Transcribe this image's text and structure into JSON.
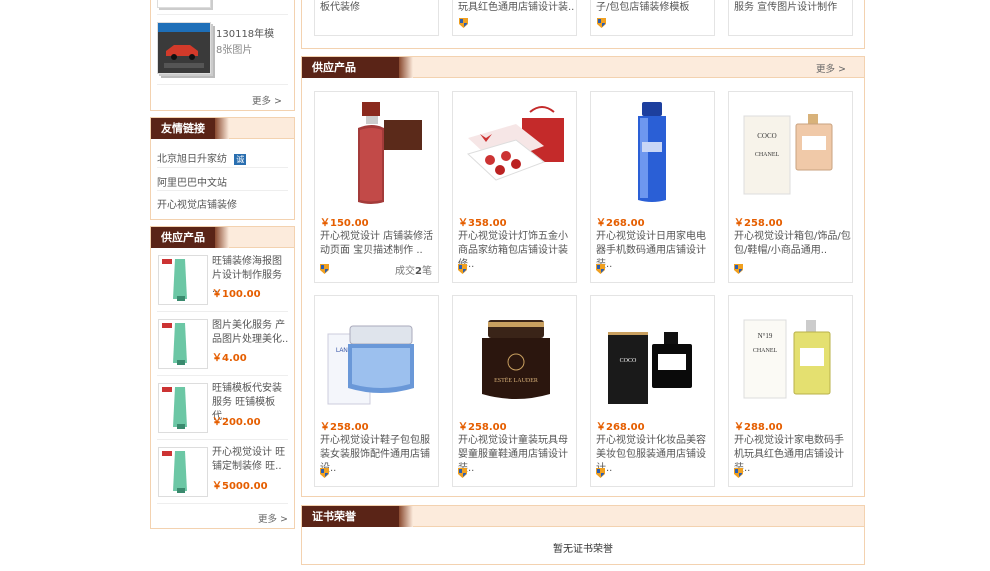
{
  "top_strip": {
    "items": [
      "板代装修",
      "玩具红色通用店铺设计装..",
      "子/包包店铺装修模板",
      "服务 宣传图片设计制作"
    ]
  },
  "side_album": {
    "title": "130118年模",
    "count": "8张图片",
    "more": "更多 >"
  },
  "friend_links": {
    "title": "友情链接",
    "links": [
      "北京旭日升家纺",
      "阿里巴巴中文站",
      "开心视觉店铺装修"
    ],
    "badge": "诚"
  },
  "side_supply": {
    "title": "供应产品",
    "more": "更多 >",
    "items": [
      {
        "name": "旺铺装修海报图片设计制作服务 ..",
        "price": "￥100.00"
      },
      {
        "name": "图片美化服务 产品图片处理美化..",
        "price": "￥4.00"
      },
      {
        "name": "旺铺模板代安装服务 旺铺模板代..",
        "price": "￥200.00"
      },
      {
        "name": "开心视觉设计 旺铺定制装修 旺..",
        "price": "￥5000.00"
      }
    ]
  },
  "main_supply": {
    "title": "供应产品",
    "more": "更多 >",
    "products": [
      {
        "price": "￥150.00",
        "name": "开心视觉设计 店铺装修活动页面 宝贝描述制作 ..",
        "sales_label": "成交",
        "sales_num": "2",
        "sales_unit": "笔",
        "icon": "toner-bottle"
      },
      {
        "price": "￥358.00",
        "name": "开心视觉设计灯饰五金小商品家纺箱包店铺设计装修..",
        "sales_label": "",
        "sales_num": "",
        "sales_unit": "",
        "icon": "gift-set"
      },
      {
        "price": "￥268.00",
        "name": "开心视觉设计日用家电电器手机数码通用店铺设计装..",
        "sales_label": "",
        "sales_num": "",
        "sales_unit": "",
        "icon": "blue-lotion"
      },
      {
        "price": "￥258.00",
        "name": "开心视觉设计箱包/饰品/包包/鞋帽/小商品通用..",
        "sales_label": "",
        "sales_num": "",
        "sales_unit": "",
        "icon": "coco-perfume"
      },
      {
        "price": "￥258.00",
        "name": "开心视觉设计鞋子包包服装女装服饰配件通用店铺设..",
        "sales_label": "",
        "sales_num": "",
        "sales_unit": "",
        "icon": "laneige-jar"
      },
      {
        "price": "￥258.00",
        "name": "开心视觉设计童装玩具母婴童服童鞋通用店铺设计装..",
        "sales_label": "",
        "sales_num": "",
        "sales_unit": "",
        "icon": "estee-jar"
      },
      {
        "price": "￥268.00",
        "name": "开心视觉设计化妆品美容美妆包包服装通用店铺设计..",
        "sales_label": "",
        "sales_num": "",
        "sales_unit": "",
        "icon": "coco-noir"
      },
      {
        "price": "￥288.00",
        "name": "开心视觉设计家电数码手机玩具红色通用店铺设计装..",
        "sales_label": "",
        "sales_num": "",
        "sales_unit": "",
        "icon": "chanel-no19"
      }
    ]
  },
  "certificates": {
    "title": "证书荣誉",
    "empty_text": "暂无证书荣誉"
  },
  "product_labels": {
    "coco": "COCO",
    "chanel": "CHANEL",
    "laneige": "LANEIGE",
    "estee": "ESTĒE LAUDER",
    "no19": "N°19"
  },
  "colors": {
    "header_dark": "#5a2417",
    "header_light": "#fcebdc",
    "border": "#f3d2b0",
    "price": "#e55e00"
  }
}
